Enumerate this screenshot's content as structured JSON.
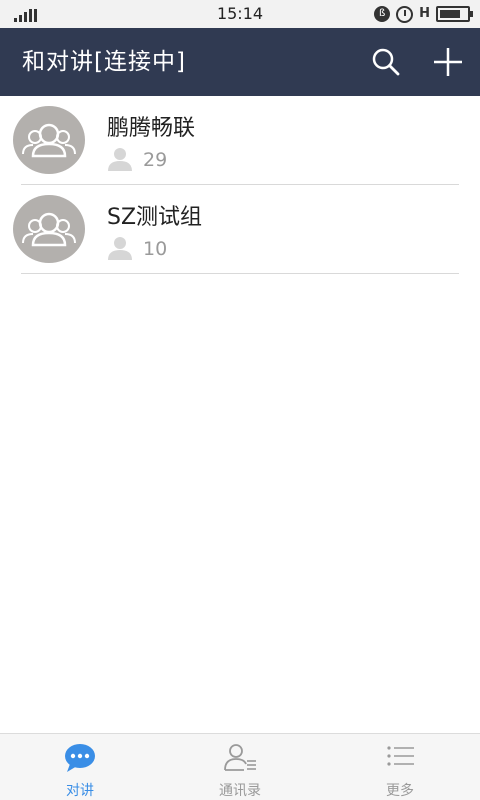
{
  "status_bar": {
    "time": "15:14",
    "h_indicator": "H",
    "battery_level": 0.75,
    "icons": [
      "signal-icon",
      "bluetooth-icon",
      "alarm-icon",
      "battery-icon"
    ]
  },
  "header": {
    "title": "和对讲[连接中]",
    "icons": [
      "search-icon",
      "add-icon"
    ],
    "background_color": "#303a52"
  },
  "groups": [
    {
      "name": "鹏腾畅联",
      "member_count": "29"
    },
    {
      "name": "SZ测试组",
      "member_count": "10"
    }
  ],
  "tabs": [
    {
      "label": "对讲",
      "icon": "chat-bubble-icon",
      "active": true
    },
    {
      "label": "通讯录",
      "icon": "contacts-icon",
      "active": false
    },
    {
      "label": "更多",
      "icon": "list-menu-icon",
      "active": false
    }
  ],
  "colors": {
    "accent": "#3a8ee6",
    "muted_text": "#9a9a9a",
    "avatar_gray": "#b3b0ad"
  }
}
